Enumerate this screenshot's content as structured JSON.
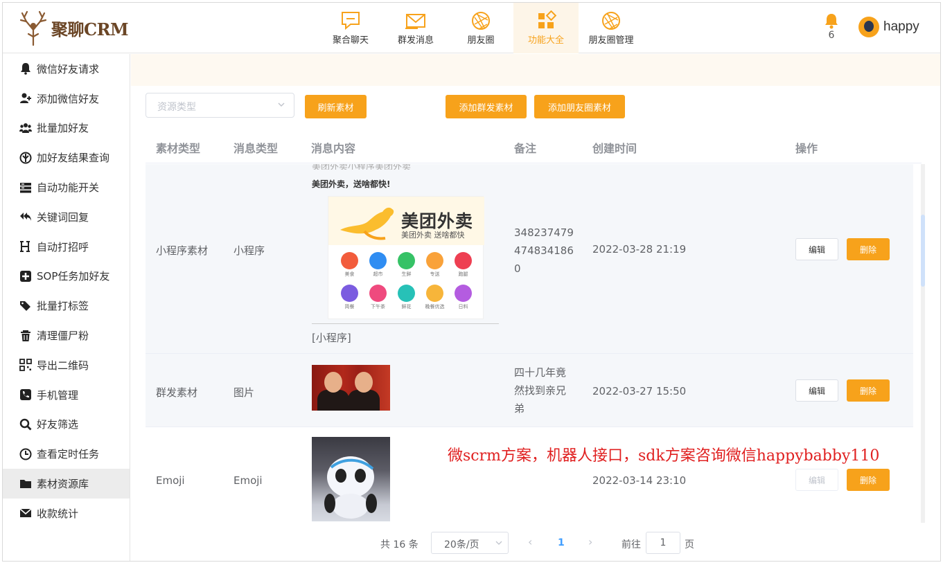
{
  "app": {
    "name": "聚聊CRM"
  },
  "nav": [
    {
      "label": "聚合聊天",
      "icon": "chat-bubble-icon"
    },
    {
      "label": "群发消息",
      "icon": "envelope-icon"
    },
    {
      "label": "朋友圈",
      "icon": "aperture-icon"
    },
    {
      "label": "功能大全",
      "icon": "grid-apps-icon",
      "active": true
    },
    {
      "label": "朋友圈管理",
      "icon": "aperture-icon"
    }
  ],
  "notifications": {
    "count": "6"
  },
  "user": {
    "name": "happy"
  },
  "sidebar": {
    "items": [
      {
        "label": "微信好友请求",
        "icon": "bell-icon"
      },
      {
        "label": "添加微信好友",
        "icon": "user-plus-icon"
      },
      {
        "label": "批量加好友",
        "icon": "users-icon"
      },
      {
        "label": "加好友结果查询",
        "icon": "rebel-icon"
      },
      {
        "label": "自动功能开关",
        "icon": "server-icon"
      },
      {
        "label": "关键词回复",
        "icon": "reply-all-icon"
      },
      {
        "label": "自动打招呼",
        "icon": "heading-icon"
      },
      {
        "label": "SOP任务加好友",
        "icon": "plus-square-icon"
      },
      {
        "label": "批量打标签",
        "icon": "tags-icon"
      },
      {
        "label": "清理僵尸粉",
        "icon": "trash-icon"
      },
      {
        "label": "导出二维码",
        "icon": "qrcode-icon"
      },
      {
        "label": "手机管理",
        "icon": "phone-square-icon"
      },
      {
        "label": "好友筛选",
        "icon": "search-icon"
      },
      {
        "label": "查看定时任务",
        "icon": "clock-icon"
      },
      {
        "label": "素材资源库",
        "icon": "folder-icon",
        "active": true
      },
      {
        "label": "收款统计",
        "icon": "envelope-icon"
      }
    ]
  },
  "toolbar": {
    "resource_type_placeholder": "资源类型",
    "refresh": "刷新素材",
    "add_group": "添加群发素材",
    "add_moments": "添加朋友圈素材"
  },
  "table": {
    "headers": [
      "素材类型",
      "消息类型",
      "消息内容",
      "备注",
      "创建时间",
      "操作"
    ],
    "rows": [
      {
        "material_type": "小程序素材",
        "message_type": "小程序",
        "content": {
          "clipped_line": "美团外卖小程序美团外卖",
          "title": "美团外卖，送啥都快!",
          "brand": "美团外卖",
          "slogan": "美团外卖 送啥都快",
          "tag": "[小程序]",
          "icons": [
            {
              "label": "美食",
              "color": "#f25c3c"
            },
            {
              "label": "超市",
              "color": "#2f8df2"
            },
            {
              "label": "生鲜",
              "color": "#36c266"
            },
            {
              "label": "专送",
              "color": "#f9a23a"
            },
            {
              "label": "跑腿",
              "color": "#ee3f52"
            },
            {
              "label": "简餐",
              "color": "#7b5ce0"
            },
            {
              "label": "下午茶",
              "color": "#ef4a7e"
            },
            {
              "label": "鲜花",
              "color": "#27c1b7"
            },
            {
              "label": "晚餐优选",
              "color": "#f7b53a"
            },
            {
              "label": "日料",
              "color": "#b45ce0"
            }
          ]
        },
        "note": [
          "348237479",
          "474834186",
          "0"
        ],
        "created": "2022-03-28 21:19",
        "edit": "编辑",
        "delete": "删除"
      },
      {
        "material_type": "群发素材",
        "message_type": "图片",
        "note": [
          "四十几年竟",
          "然找到亲兄",
          "弟"
        ],
        "created": "2022-03-27 15:50",
        "edit": "编辑",
        "delete": "删除"
      },
      {
        "material_type": "Emoji",
        "message_type": "Emoji",
        "note": [],
        "created": "2022-03-14 23:10",
        "edit": "编辑",
        "delete": "删除"
      }
    ]
  },
  "watermark": "微scrm方案，机器人接口，sdk方案咨询微信happybabby110",
  "pagination": {
    "total": "共 16 条",
    "page_size": "20条/页",
    "current": "1",
    "goto_label": "前往",
    "goto_value": "1",
    "page_suffix": "页"
  },
  "colors": {
    "accent": "#f7a21b",
    "brand": "#6b4626",
    "link": "#409eff",
    "watermark": "#e02020"
  }
}
